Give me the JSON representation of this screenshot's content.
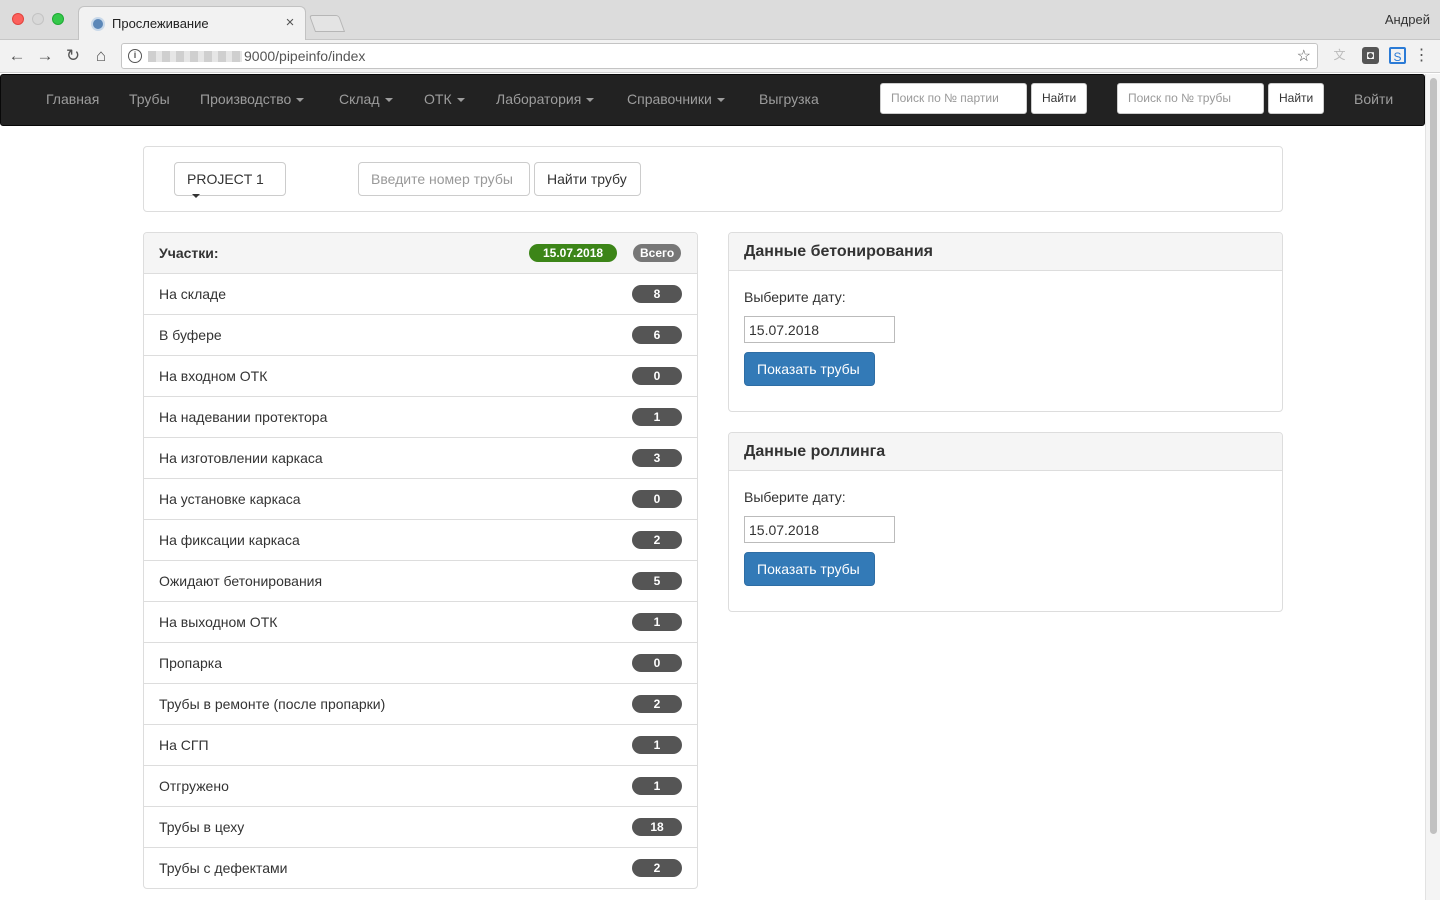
{
  "browser": {
    "tab_title": "Прослеживание",
    "tab_close": "×",
    "profile": "Андрей",
    "url": "9000/pipeinfo/index",
    "back": "←",
    "forward": "→",
    "reload": "↻",
    "home": "⌂",
    "star": "☆"
  },
  "navbar": {
    "items": [
      "Главная",
      "Трубы",
      "Производство",
      "Склад",
      "ОТК",
      "Лаборатория",
      "Справочники",
      "Выгрузка"
    ],
    "batch_search_placeholder": "Поиск по № партии",
    "batch_find": "Найти",
    "pipe_search_placeholder": "Поиск по № трубы",
    "pipe_find": "Найти",
    "login": "Войти"
  },
  "search": {
    "project": "PROJECT 1",
    "pipe_placeholder": "Введите номер трубы",
    "find_pipe": "Найти трубу"
  },
  "sections": {
    "title": "Участки:",
    "date": "15.07.2018",
    "total_label": "Всего",
    "rows": [
      {
        "label": "На складе",
        "count": "8"
      },
      {
        "label": "В буфере",
        "count": "6"
      },
      {
        "label": "На входном ОТК",
        "count": "0"
      },
      {
        "label": "На надевании протектора",
        "count": "1"
      },
      {
        "label": "На изготовлении каркаса",
        "count": "3"
      },
      {
        "label": "На установке каркаса",
        "count": "0"
      },
      {
        "label": "На фиксации каркаса",
        "count": "2"
      },
      {
        "label": "Ожидают бетонирования",
        "count": "5"
      },
      {
        "label": "На выходном ОТК",
        "count": "1"
      },
      {
        "label": "Пропарка",
        "count": "0"
      },
      {
        "label": "Трубы в ремонте (после пропарки)",
        "count": "2"
      },
      {
        "label": "На СГП",
        "count": "1"
      },
      {
        "label": "Отгружено",
        "count": "1"
      },
      {
        "label": "Трубы в цеху",
        "count": "18"
      },
      {
        "label": "Трубы с дефектами",
        "count": "2"
      }
    ]
  },
  "concreting": {
    "title": "Данные бетонирования",
    "date_label": "Выберите дату:",
    "date_value": "15.07.2018",
    "button": "Показать трубы"
  },
  "rolling": {
    "title": "Данные роллинга",
    "date_label": "Выберите дату:",
    "date_value": "15.07.2018",
    "button": "Показать трубы"
  },
  "colors": {
    "navbar_bg": "#222222",
    "primary": "#337ab7",
    "date_badge": "#3c8518",
    "count_badge": "#555555"
  }
}
